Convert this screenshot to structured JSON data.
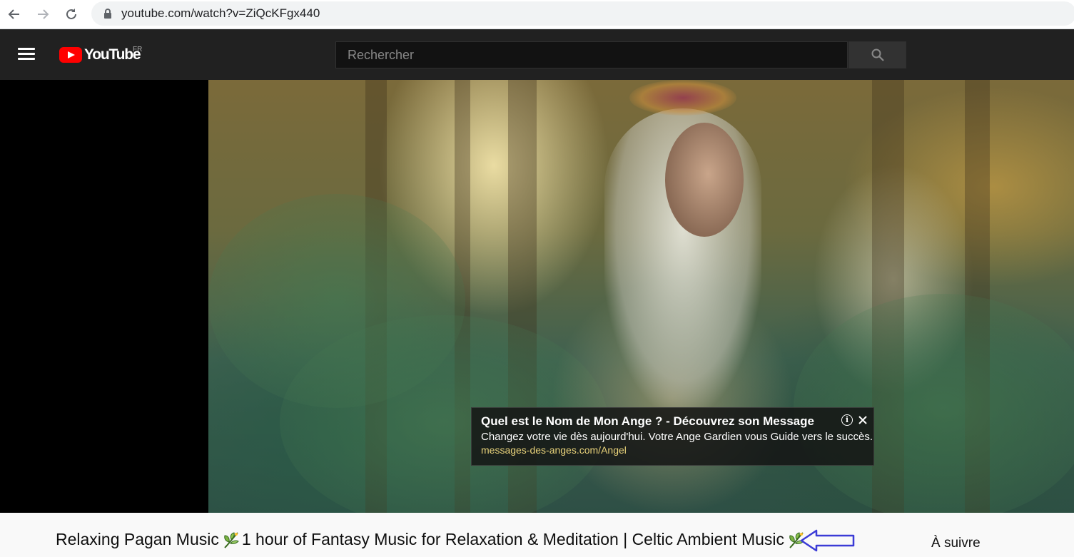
{
  "browser": {
    "url": "youtube.com/watch?v=ZiQcKFgx440"
  },
  "header": {
    "logo_text": "YouTube",
    "region": "FR",
    "search_placeholder": "Rechercher"
  },
  "ad": {
    "title": "Quel est le Nom de Mon Ange ? - Découvrez son Message",
    "description": "Changez votre vie dès aujourd'hui. Votre Ange Gardien vous Guide vers le succès.",
    "url": "messages-des-anges.com/Angel",
    "info_glyph": "i"
  },
  "video": {
    "title_part1": "Relaxing Pagan Music ",
    "title_part2": "1 hour of Fantasy Music for Relaxation & Meditation | Celtic Ambient Music "
  },
  "sidebar": {
    "up_next_label": "À suivre"
  },
  "colors": {
    "youtube_red": "#ff0000",
    "header_bg": "#212121",
    "annotation_arrow": "#3b3bd6",
    "ad_url": "#e8d27a"
  },
  "icons": {
    "back": "back-arrow-icon",
    "forward": "forward-arrow-icon",
    "reload": "reload-icon",
    "lock": "lock-icon",
    "menu": "hamburger-menu-icon",
    "search": "search-icon",
    "info": "info-icon",
    "close": "close-icon",
    "leaf": "herb-leaf-icon",
    "annotation": "left-arrow-annotation-icon"
  }
}
